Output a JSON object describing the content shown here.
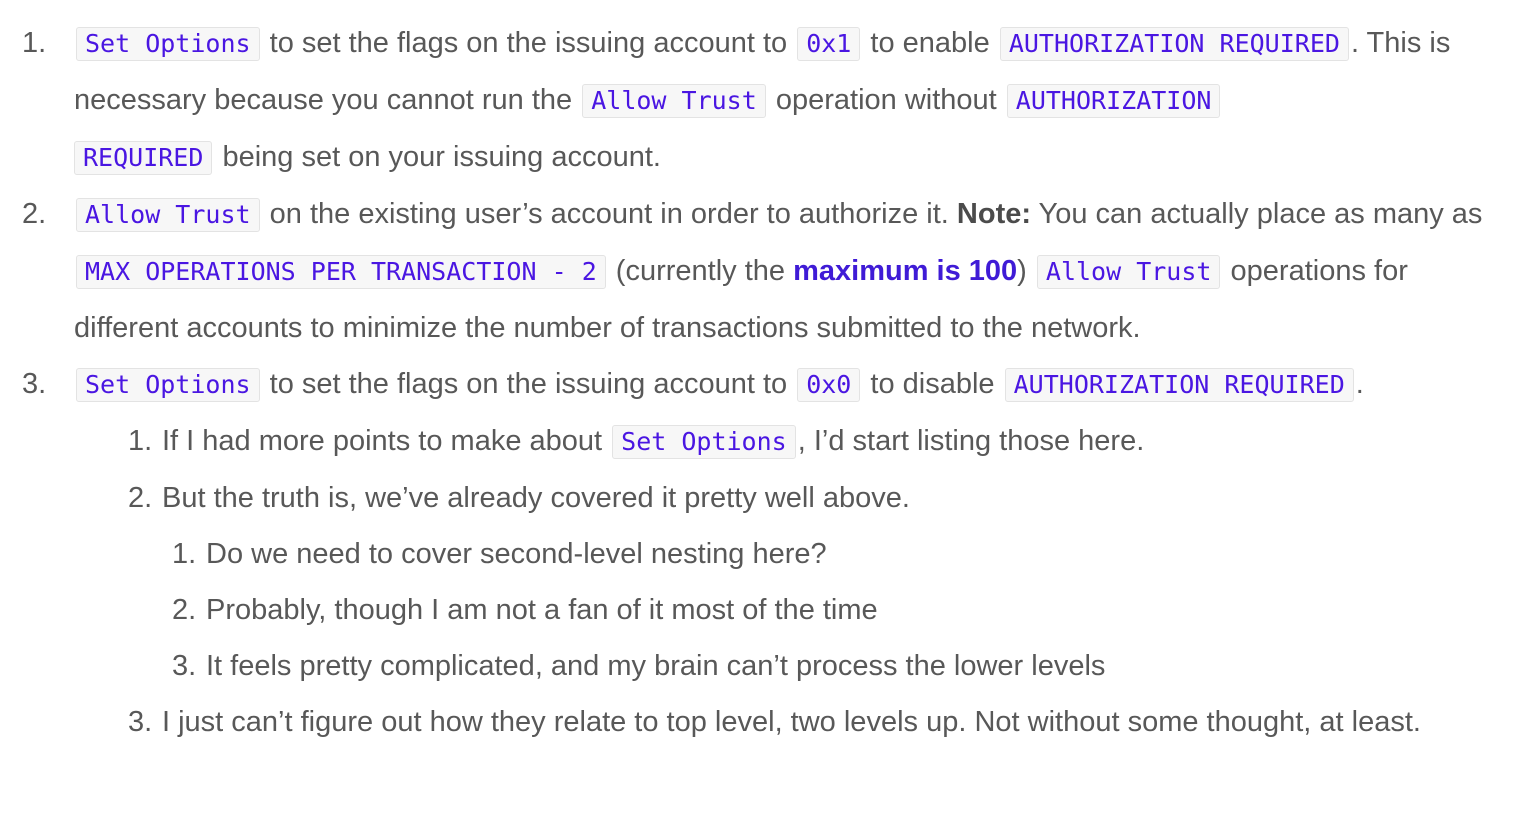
{
  "list": {
    "item1": {
      "num": "1.",
      "code_set_options": "Set Options",
      "t1": " to set the flags on the issuing account to ",
      "code_0x1": "0x1",
      "t2": " to enable ",
      "code_auth_req": "AUTHORIZATION REQUIRED",
      "t3": ". This is necessary because you cannot run the ",
      "code_allow_trust": "Allow Trust",
      "t4": " operation without ",
      "code_auth_a": "AUTHORIZATION",
      "code_auth_b": "REQUIRED",
      "t5": " being set on your issuing account."
    },
    "item2": {
      "num": "2.",
      "code_allow_trust": "Allow Trust",
      "t1": " on the existing user’s account in order to authorize it. ",
      "note_label": "Note:",
      "t2": " You can actually place as many as ",
      "code_max_ops": "MAX OPERATIONS PER TRANSACTION - 2",
      "t3": " (currently the ",
      "link_max": "maximum is 100",
      "t4": ") ",
      "code_allow_trust_2": "Allow Trust",
      "t5": " operations for different accounts to minimize the number of transactions submitted to the network."
    },
    "item3": {
      "num": "3.",
      "code_set_options": "Set Options",
      "t1": " to set the flags on the issuing account to ",
      "code_0x0": "0x0",
      "t2": " to disable ",
      "code_auth_req": "AUTHORIZATION REQUIRED",
      "t3": ".",
      "sub": [
        {
          "num": "1.",
          "t1": "If I had more points to make about ",
          "code": "Set Options",
          "t2": ", I’d start listing those here."
        },
        {
          "num": "2.",
          "t1": "But the truth is, we’ve already covered it pretty well above.",
          "sub": [
            {
              "num": "1.",
              "text": "Do we need to cover second-level nesting here?"
            },
            {
              "num": "2.",
              "text": "Probably, though I am not a fan of it most of the time"
            },
            {
              "num": "3.",
              "text": "It feels pretty complicated, and my brain can’t process the lower levels"
            }
          ]
        },
        {
          "num": "3.",
          "t1": "I just can’t figure out how they relate to top level, two levels up. Not without some thought, at least."
        }
      ]
    }
  },
  "colors": {
    "text": "#585858",
    "code_text": "#4a16e2",
    "code_bg": "#f7f7f7",
    "link": "#3f1bd6"
  }
}
